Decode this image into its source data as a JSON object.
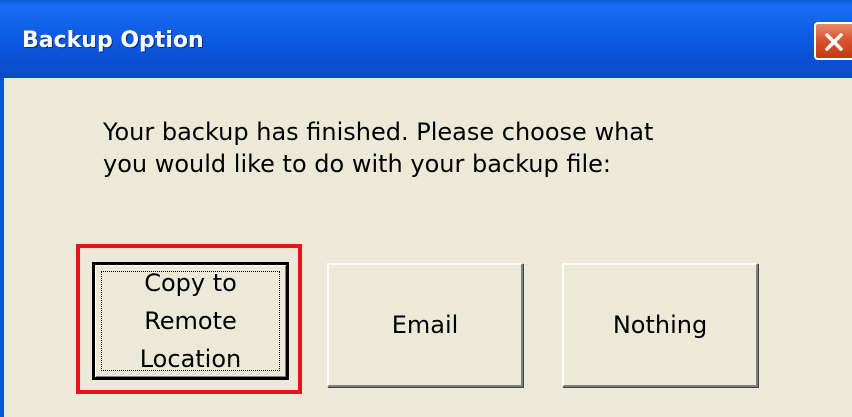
{
  "window": {
    "title": "Backup Option"
  },
  "message": {
    "line1": "Your backup has finished. Please choose what",
    "line2": "you would like to do with your backup file:"
  },
  "buttons": {
    "copy_label": "Copy to\nRemote\nLocation",
    "email_label": "Email",
    "nothing_label": "Nothing"
  },
  "colors": {
    "titlebar": "#0b53d8",
    "dialog_bg": "#ece9d8",
    "highlight": "#e8141b",
    "close_button": "#d8562f"
  },
  "icons": {
    "close": "close-x-icon"
  }
}
